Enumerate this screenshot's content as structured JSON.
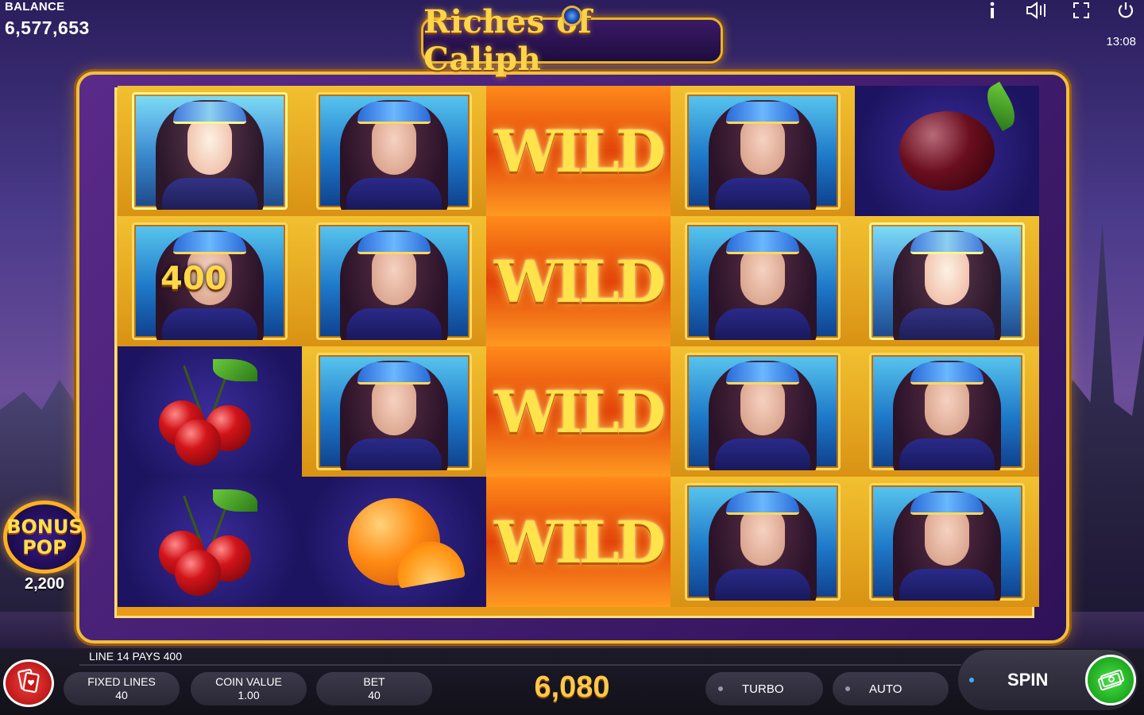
{
  "hud": {
    "balance_label": "BALANCE",
    "balance_value": "6,577,653",
    "clock": "13:08",
    "icons": [
      "info-icon",
      "sound-icon",
      "fullscreen-icon",
      "power-icon"
    ]
  },
  "logo": {
    "title": "Riches of Caliph"
  },
  "reels": {
    "columns": [
      [
        "lady",
        "lady",
        "cherries",
        "cherries"
      ],
      [
        "lady",
        "lady",
        "lady",
        "orange"
      ],
      [
        "wild",
        "wild",
        "wild",
        "wild"
      ],
      [
        "lady",
        "lady",
        "lady",
        "lady"
      ],
      [
        "plum",
        "lady",
        "lady",
        "lady"
      ]
    ],
    "wild_label": "WILD",
    "win_overlay": "400"
  },
  "bonus_pop": {
    "line1": "BONUS",
    "line2": "POP",
    "amount": "2,200"
  },
  "status": {
    "line_pays": "LINE 14 PAYS 400"
  },
  "controls": {
    "fixed_lines_label": "FIXED LINES",
    "fixed_lines_value": "40",
    "coin_value_label": "COIN VALUE",
    "coin_value_value": "1.00",
    "bet_label": "BET",
    "bet_value": "40",
    "win_total": "6,080",
    "turbo_label": "TURBO",
    "auto_label": "AUTO",
    "spin_label": "SPIN"
  },
  "colors": {
    "gold": "#f0c040",
    "frame_purple": "#5a2a8a",
    "spin_green": "#18a018",
    "paytable_red": "#d21e1e"
  }
}
